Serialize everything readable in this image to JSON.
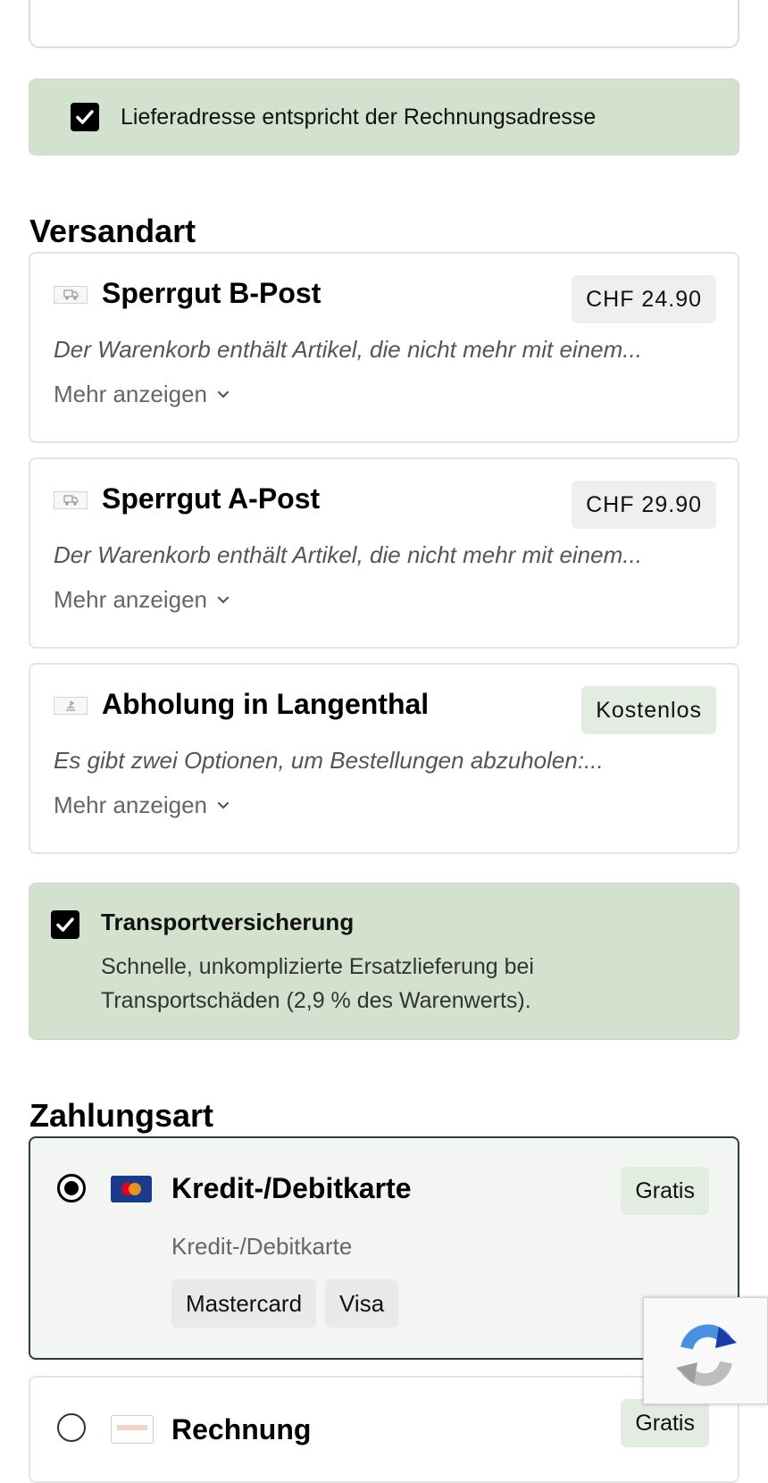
{
  "delivery_same_as_billing": {
    "label": "Lieferadresse entspricht der Rechnungsadresse",
    "checked": true
  },
  "shipping": {
    "title": "Versandart",
    "more_label": "Mehr anzeigen",
    "options": [
      {
        "name": "Sperrgut B-Post",
        "price": "CHF 24.90",
        "description": "Der Warenkorb enthält Artikel, die nicht mehr mit einem...",
        "icon": "truck-icon"
      },
      {
        "name": "Sperrgut A-Post",
        "price": "CHF 29.90",
        "description": "Der Warenkorb enthält Artikel, die nicht mehr mit einem...",
        "icon": "truck-icon"
      },
      {
        "name": "Abholung in Langenthal",
        "price": "Kostenlos",
        "description": "Es gibt zwei Optionen, um Bestellungen abzuholen:...",
        "icon": "pickup-icon"
      }
    ]
  },
  "insurance": {
    "title": "Transportversicherung",
    "description": "Schnelle, unkomplizierte Ersatzlieferung bei Transportschäden (2,9 % des Warenwerts).",
    "checked": true
  },
  "payment": {
    "title": "Zahlungsart",
    "options": [
      {
        "name": "Kredit-/Debitkarte",
        "price": "Gratis",
        "subtitle": "Kredit-/Debitkarte",
        "methods": [
          "Mastercard",
          "Visa"
        ],
        "selected": true,
        "icon": "credit-card-icon"
      },
      {
        "name": "Rechnung",
        "price": "Gratis",
        "selected": false,
        "icon": "invoice-icon"
      }
    ]
  },
  "colors": {
    "accent_green_bg": "#d3e2cf",
    "badge_green_bg": "#e2ece0",
    "selected_border": "#2c3e3a"
  }
}
